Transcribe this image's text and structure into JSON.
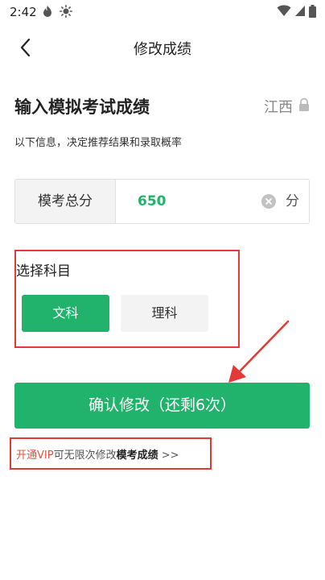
{
  "status_bar": {
    "time": "2:42"
  },
  "nav": {
    "title": "修改成绩"
  },
  "section": {
    "title": "输入模拟考试成绩",
    "province": "江西",
    "subtitle": "以下信息，决定推荐结果和录取概率"
  },
  "score": {
    "label": "模考总分",
    "value": "650",
    "unit": "分"
  },
  "subjects": {
    "title": "选择科目",
    "options": [
      {
        "label": "文科",
        "selected": true
      },
      {
        "label": "理科",
        "selected": false
      }
    ]
  },
  "confirm": {
    "label": "确认修改（还剩6次）"
  },
  "vip": {
    "part1": "开通VIP",
    "part2": "可无限次修改",
    "part3": "模考成绩",
    "part4": " >>"
  },
  "colors": {
    "accent": "#21b36b",
    "highlight": "#e53935",
    "vip": "#e8503a"
  }
}
